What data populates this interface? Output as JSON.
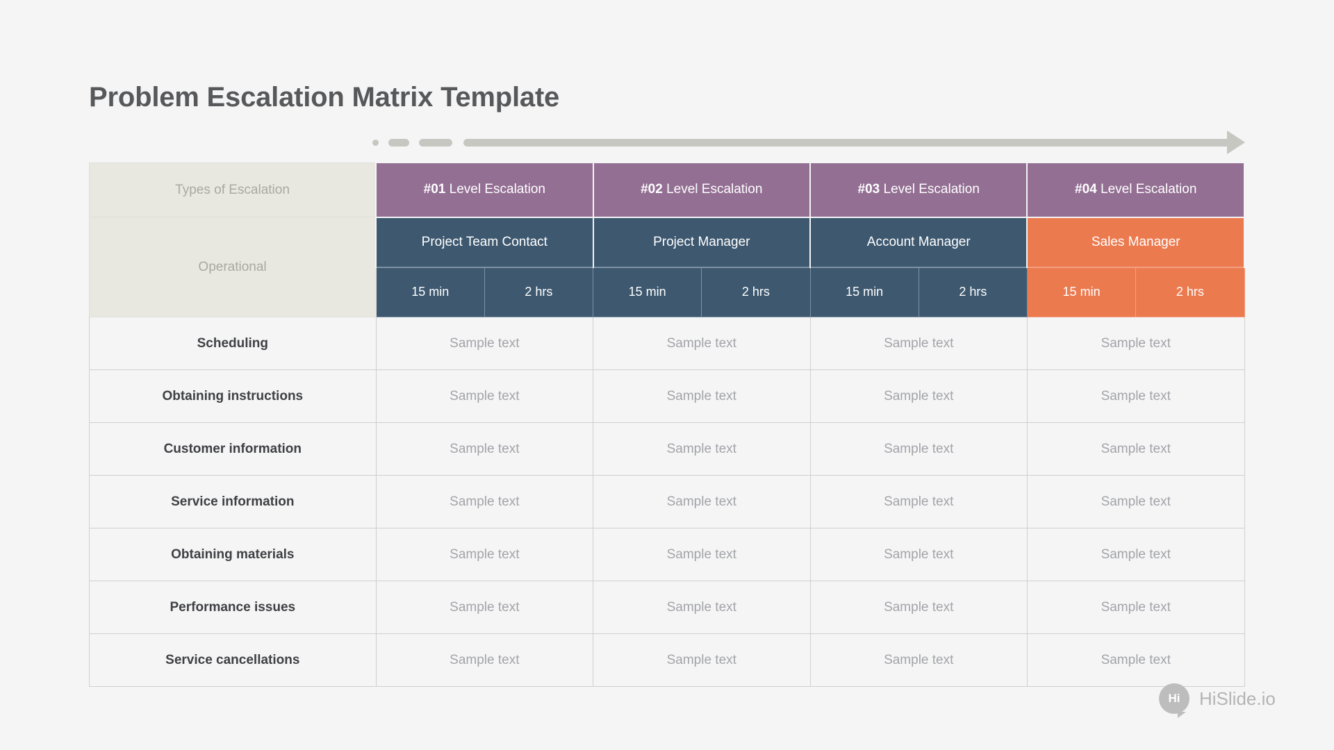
{
  "slide": {
    "title": "Problem Escalation Matrix Template",
    "background_color": "#f5f5f6"
  },
  "colors": {
    "title_text": "#57585a",
    "arrow": "#c6c7c0",
    "beige_header": "#e8e8e0",
    "purple_level": "#936f93",
    "slate_role": "#3d586f",
    "orange_role": "#ec7a4f",
    "row_label_text": "#3f4043",
    "sample_text": "#a3a4a8",
    "grid_line": "#cfcfcb"
  },
  "progress_arrow": {
    "name": "progress-arrow",
    "segments": [
      "dot",
      "short-dash",
      "long-dash",
      "line"
    ],
    "head": "arrow-head-right"
  },
  "table": {
    "corner_label": "Types of Escalation",
    "section_label": "Operational",
    "levels": [
      {
        "num": "#01",
        "label": " Level Escalation"
      },
      {
        "num": "#02",
        "label": " Level Escalation"
      },
      {
        "num": "#03",
        "label": " Level Escalation"
      },
      {
        "num": "#04",
        "label": " Level Escalation"
      }
    ],
    "roles": [
      {
        "name": "Project Team Contact",
        "color": "#3d586f"
      },
      {
        "name": "Project Manager",
        "color": "#3d586f"
      },
      {
        "name": "Account Manager",
        "color": "#3d586f"
      },
      {
        "name": "Sales Manager",
        "color": "#ec7a4f"
      }
    ],
    "times": [
      {
        "first": "15 min",
        "second": "2 hrs"
      },
      {
        "first": "15 min",
        "second": "2 hrs"
      },
      {
        "first": "15 min",
        "second": "2 hrs"
      },
      {
        "first": "15 min",
        "second": "2 hrs"
      }
    ],
    "rows": [
      {
        "label": "Scheduling",
        "cells": [
          "Sample text",
          "Sample text",
          "Sample text",
          "Sample text"
        ]
      },
      {
        "label": "Obtaining instructions",
        "cells": [
          "Sample text",
          "Sample text",
          "Sample text",
          "Sample text"
        ]
      },
      {
        "label": "Customer information",
        "cells": [
          "Sample text",
          "Sample text",
          "Sample text",
          "Sample text"
        ]
      },
      {
        "label": "Service information",
        "cells": [
          "Sample text",
          "Sample text",
          "Sample text",
          "Sample text"
        ]
      },
      {
        "label": "Obtaining materials",
        "cells": [
          "Sample text",
          "Sample text",
          "Sample text",
          "Sample text"
        ]
      },
      {
        "label": "Performance issues",
        "cells": [
          "Sample text",
          "Sample text",
          "Sample text",
          "Sample text"
        ]
      },
      {
        "label": "Service cancellations",
        "cells": [
          "Sample text",
          "Sample text",
          "Sample text",
          "Sample text"
        ]
      }
    ]
  },
  "footer": {
    "logo_badge": "Hi",
    "logo_text": "HiSlide.io"
  }
}
